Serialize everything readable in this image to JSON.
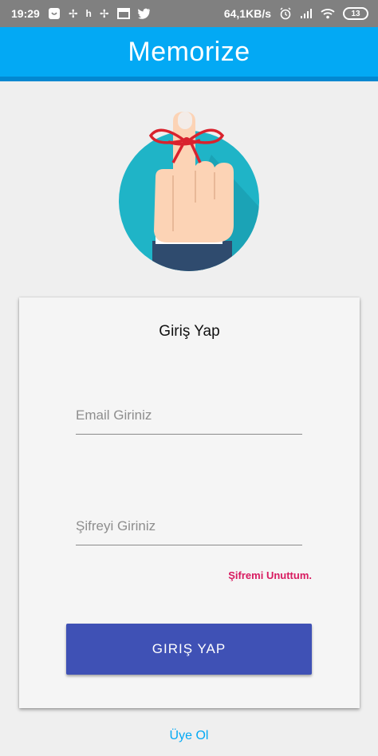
{
  "status_bar": {
    "time": "19:29",
    "network_speed": "64,1KB/s",
    "battery_level": "13",
    "left_icons": [
      "notification-icon",
      "fan-icon",
      "h-signal-icon",
      "fan-icon",
      "calendar-icon",
      "twitter-icon"
    ],
    "right_icons": [
      "alarm-icon",
      "cell-signal-icon",
      "wifi-icon",
      "battery-icon"
    ]
  },
  "app_bar": {
    "title": "Memorize",
    "color": "#03a9f4"
  },
  "login_card": {
    "title": "Giriş Yap",
    "email_placeholder": "Email Giriniz",
    "password_placeholder": "Şifreyi Giriniz",
    "forgot_password_label": "Şifremi Unuttum.",
    "login_button_label": "GIRIŞ YAP",
    "button_color": "#3f51b5",
    "link_color": "#d81b60"
  },
  "footer": {
    "register_label": "Üye Ol"
  }
}
